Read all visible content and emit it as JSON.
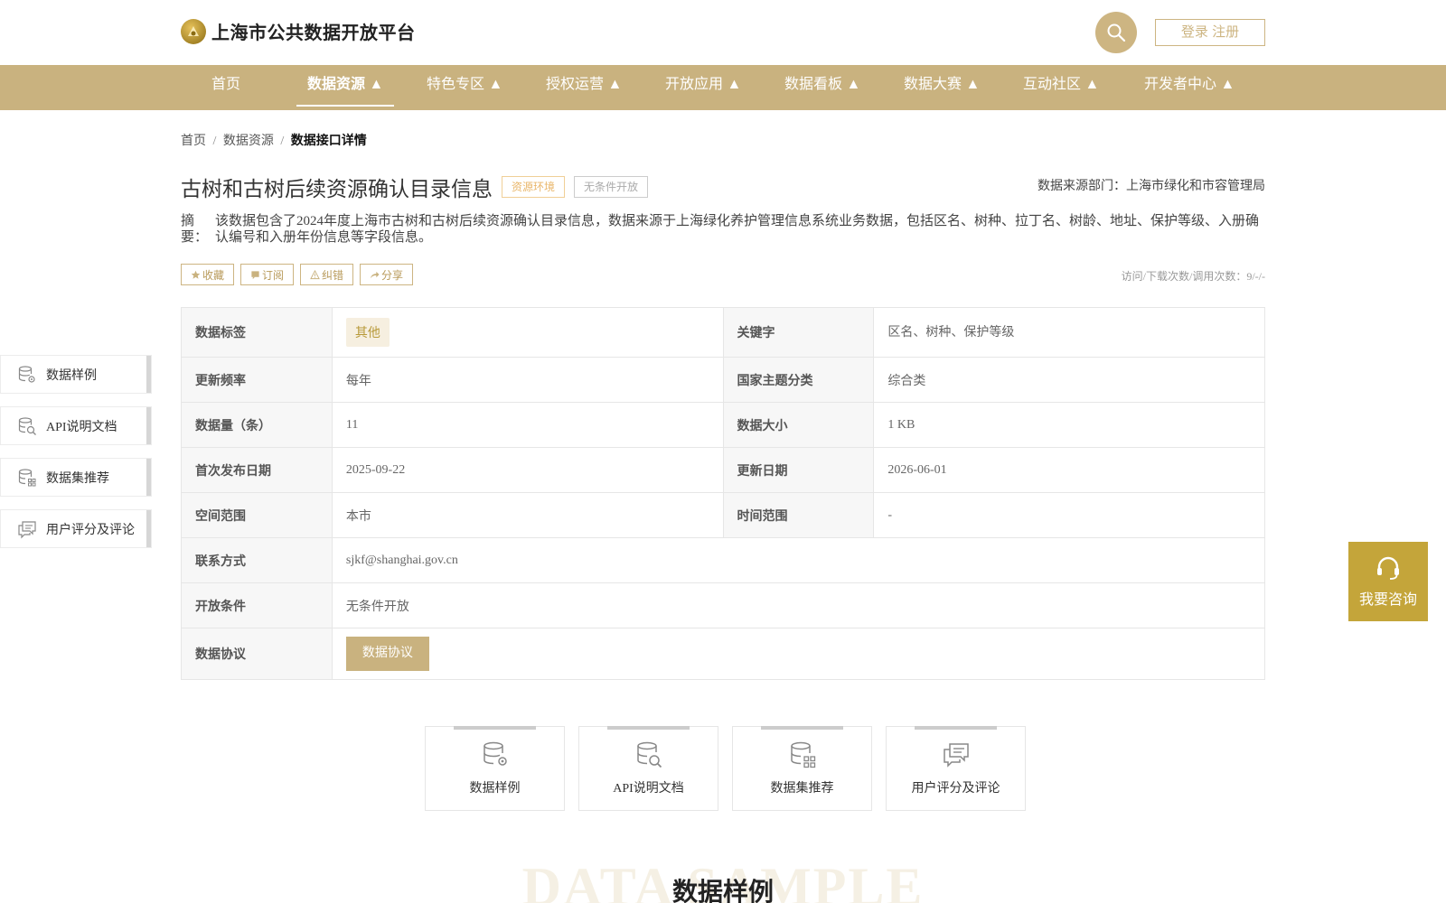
{
  "header": {
    "site_title": "上海市公共数据开放平台",
    "login_label": "登录 注册"
  },
  "nav": {
    "items": [
      {
        "label": "首页"
      },
      {
        "label": "数据资源 ▲"
      },
      {
        "label": "特色专区 ▲"
      },
      {
        "label": "授权运营 ▲"
      },
      {
        "label": "开放应用 ▲"
      },
      {
        "label": "数据看板 ▲"
      },
      {
        "label": "数据大赛 ▲"
      },
      {
        "label": "互动社区 ▲"
      },
      {
        "label": "开发者中心 ▲"
      }
    ]
  },
  "breadcrumb": {
    "home": "首页",
    "sep": "/",
    "section": "数据资源",
    "current": "数据接口详情"
  },
  "dataset": {
    "title": "古树和古树后续资源确认目录信息",
    "tag_env": "资源环境",
    "tag_open": "无条件开放",
    "source_dept": "数据来源部门：上海市绿化和市容管理局",
    "summary_label": "摘 要：",
    "summary": "该数据包含了2024年度上海市古树和古树后续资源确认目录信息，数据来源于上海绿化养护管理信息系统业务数据，包括区名、树种、拉丁名、树龄、地址、保护等级、入册确认编号和入册年份信息等字段信息。",
    "visits": "访问/下载次数/调用次数：9/-/-"
  },
  "actions": {
    "favorite": "收藏",
    "subscribe": "订阅",
    "correct": "纠错",
    "share": "分享"
  },
  "info": {
    "label_key": "数据标签",
    "label_value": "其他",
    "keyword_key": "关键字",
    "keyword_value": "区名、树种、保护等级",
    "freq_key": "更新频率",
    "freq_value": "每年",
    "theme_key": "国家主题分类",
    "theme_value": "综合类",
    "count_key": "数据量（条）",
    "count_value": "11",
    "size_key": "数据大小",
    "size_value": "1 KB",
    "first_pub_key": "首次发布日期",
    "first_pub_value": "2025-09-22",
    "update_key": "更新日期",
    "update_value": "2026-06-01",
    "space_key": "空间范围",
    "space_value": "本市",
    "time_key": "时间范围",
    "time_value": "-",
    "contact_key": "联系方式",
    "contact_value": "sjkf@shanghai.gov.cn",
    "open_key": "开放条件",
    "open_value": "无条件开放",
    "agreement_key": "数据协议",
    "agreement_btn": "数据协议"
  },
  "side_nav": {
    "sample": "数据样例",
    "api": "API说明文档",
    "recommend": "数据集推荐",
    "review": "用户评分及评论"
  },
  "cards": {
    "sample": "数据样例",
    "api": "API说明文档",
    "recommend": "数据集推荐",
    "review": "用户评分及评论"
  },
  "section": {
    "bg_text": "DATA SAMPLE",
    "title": "数据样例"
  },
  "consult": {
    "label": "我要咨询"
  },
  "colors": {
    "brand": "#c9b27f",
    "consult": "#c4a53a"
  }
}
